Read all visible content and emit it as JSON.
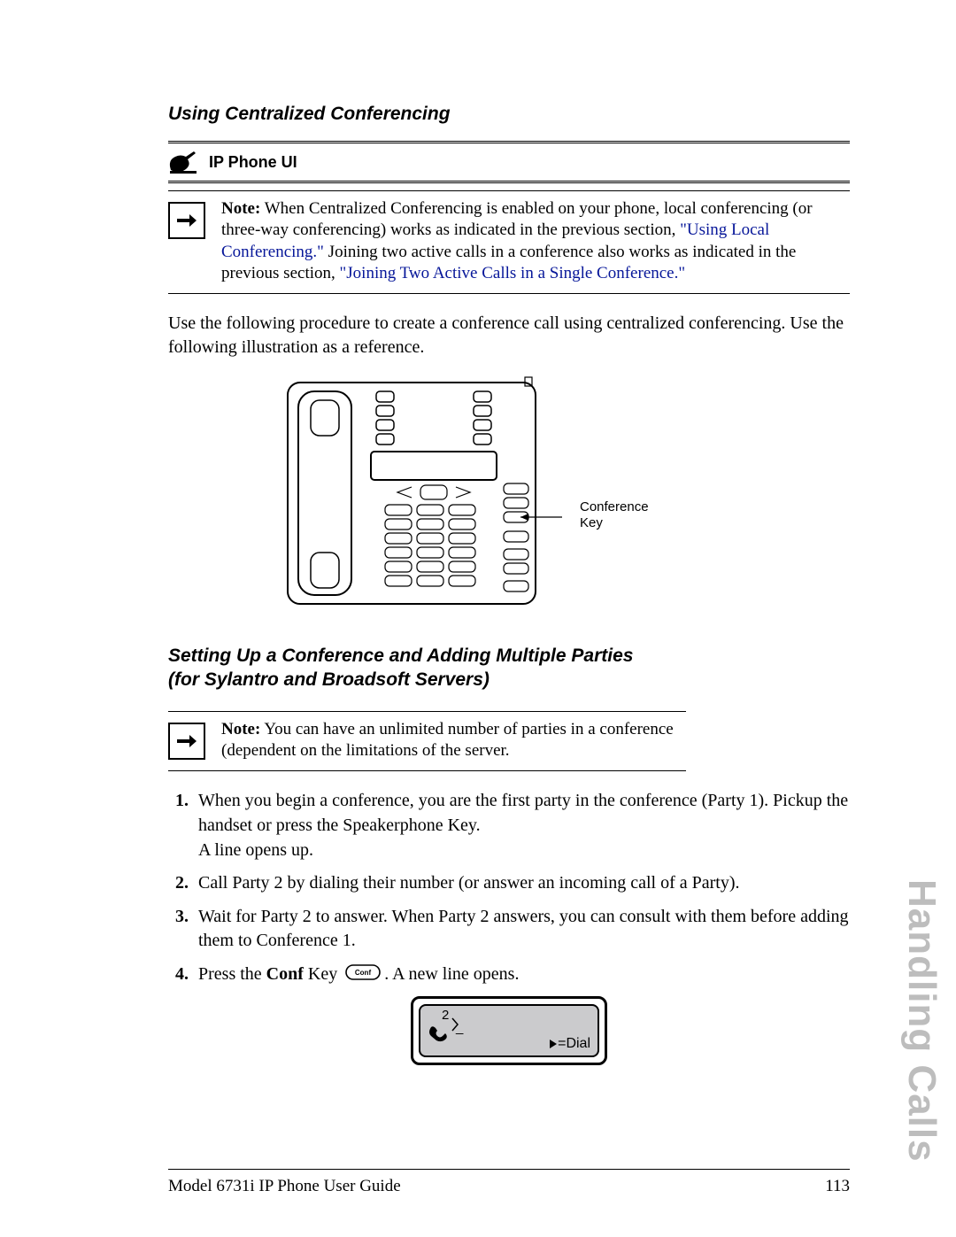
{
  "section_title": "Using Centralized Conferencing",
  "ui_heading": "IP Phone UI",
  "note1": {
    "label": "Note:",
    "t1": " When Centralized Conferencing is enabled on your phone, local conferencing (or three-way conferencing) works as indicated in the previous section, ",
    "link1": "\"Using Local Conferencing.\"",
    "t2": " Joining two active calls in a conference also works as indicated in the previous section, ",
    "link2": "\"Joining Two Active Calls in a Single Conference.\""
  },
  "intro": "Use the following procedure to create a conference call using centralized conferencing. Use the following illustration as a reference.",
  "fig_caption_l1": "Conference",
  "fig_caption_l2": "Key",
  "sub_l1": "Setting Up a Conference and Adding Multiple Parties",
  "sub_l2": "(for Sylantro and Broadsoft Servers)",
  "note2": {
    "label": "Note:",
    "text": " You can have an unlimited number of parties in a conference (dependent on the limitations of the server."
  },
  "steps": {
    "s1": "When you begin a conference, you are the first party in the conference (Party 1). Pickup the handset or press the Speakerphone Key.\nA line opens up.",
    "s2": "Call Party 2 by dialing their number (or answer an incoming call of a Party).",
    "s3": "Wait for Party 2 to answer. When Party 2 answers, you can consult with them before adding them to Conference 1.",
    "s4a": "Press the ",
    "s4b": "Conf",
    "s4c": " Key ",
    "s4d": ". A new line opens.",
    "conf_key_label": "Conf"
  },
  "lcd": {
    "num": "2",
    "dial": "=Dial"
  },
  "side_title": "Handling Calls",
  "footer_left": "Model 6731i IP Phone User Guide",
  "footer_right": "113"
}
